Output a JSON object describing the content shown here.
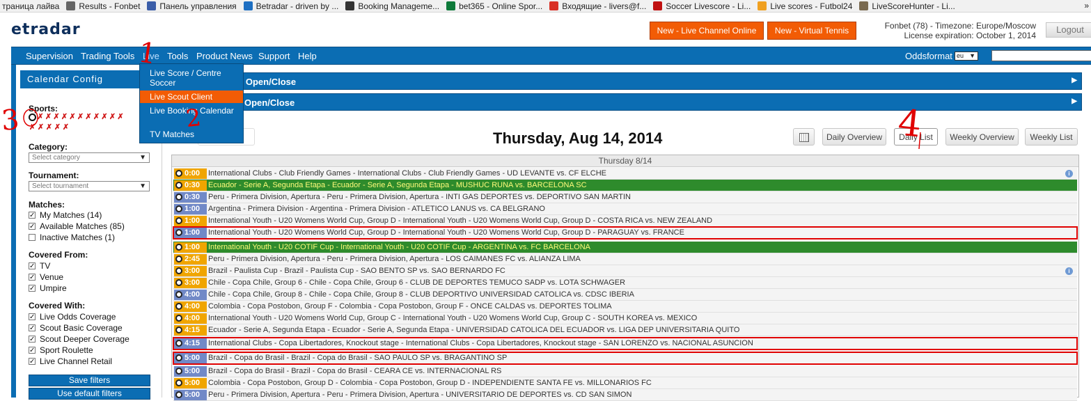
{
  "bookmarks": [
    {
      "label": "траница лайва",
      "color": "#ffffff"
    },
    {
      "label": "Results - Fonbet",
      "color": "#666666"
    },
    {
      "label": "Панель управления",
      "color": "#3a5da8"
    },
    {
      "label": "Betradar - driven by ...",
      "color": "#1d6fc2"
    },
    {
      "label": "Booking Manageme...",
      "color": "#333333"
    },
    {
      "label": "bet365 - Online Spor...",
      "color": "#0e7a3a"
    },
    {
      "label": "Входящие - livers@f...",
      "color": "#d93025"
    },
    {
      "label": "Soccer Livescore - Li...",
      "color": "#c01010"
    },
    {
      "label": "Live scores - Futbol24",
      "color": "#f0a020"
    },
    {
      "label": "LiveScoreHunter - Li...",
      "color": "#7a6a50"
    }
  ],
  "bookmarks_more": "»",
  "logo": "etradar",
  "header": {
    "btn_live_channel": "New - Live Channel Online",
    "btn_virtual_tennis": "New - Virtual Tennis",
    "account_line1": "Fonbet (78)  -  Timezone: Europe/Moscow",
    "account_line2": "License expiration: October 1, 2014",
    "logout": "Logout"
  },
  "nav": {
    "items": [
      "Supervision",
      "Trading Tools",
      "Live",
      "Tools",
      "Product News",
      "Support",
      "Help"
    ],
    "oddsformat_label": "Oddsformat",
    "oddsformat_value": "eu"
  },
  "live_menu": {
    "items": [
      "Live Score / Centre Soccer",
      "Live Scout Client",
      "Live Booking Calendar",
      "TV Matches"
    ],
    "highlighted_index": 1
  },
  "calendar_config": {
    "title": "Calendar Config",
    "sports_label": "Sports:",
    "category_label": "Category:",
    "category_placeholder": "Select category",
    "tournament_label": "Tournament:",
    "tournament_placeholder": "Select tournament",
    "matches_label": "Matches:",
    "matches": [
      {
        "label": "My Matches (14)",
        "checked": true
      },
      {
        "label": "Available Matches (85)",
        "checked": true
      },
      {
        "label": "Inactive Matches (1)",
        "checked": false
      }
    ],
    "covered_from_label": "Covered From:",
    "covered_from": [
      {
        "label": "TV",
        "checked": true
      },
      {
        "label": "Venue",
        "checked": true
      },
      {
        "label": "Umpire",
        "checked": true
      }
    ],
    "covered_with_label": "Covered With:",
    "covered_with": [
      {
        "label": "Live Odds Coverage",
        "checked": true
      },
      {
        "label": "Scout Basic Coverage",
        "checked": true
      },
      {
        "label": "Scout Deeper Coverage",
        "checked": true
      },
      {
        "label": "Sport Roulette",
        "checked": true
      },
      {
        "label": "Live Channel Retail",
        "checked": true
      }
    ],
    "save_filters": "Save filters",
    "use_default": "Use default filters"
  },
  "bars": {
    "bar1": "to Open/Close",
    "bar2": "Open/Close"
  },
  "prev_day": "day",
  "date_title": "Thursday, Aug 14, 2014",
  "view_buttons": {
    "daily_overview": "Daily Overview",
    "daily_list": "Daily List",
    "weekly_overview": "Weekly Overview",
    "weekly_list": "Weekly List"
  },
  "day_header": "Thursday 8/14",
  "matches": [
    {
      "time": "0:00",
      "text": "International Clubs - Club Friendly Games - International Clubs - Club Friendly Games - UD LEVANTE vs. CF ELCHE",
      "style": "o",
      "info": true
    },
    {
      "time": "0:30",
      "text": "Ecuador - Serie A, Segunda Etapa - Ecuador - Serie A, Segunda Etapa - MUSHUC RUNA vs. BARCELONA SC",
      "style": "g"
    },
    {
      "time": "0:30",
      "text": "Peru - Primera Division, Apertura - Peru - Primera Division, Apertura - INTI GAS DEPORTES vs. DEPORTIVO SAN MARTIN",
      "style": "b"
    },
    {
      "time": "1:00",
      "text": "Argentina - Primera Division - Argentina - Primera Division - ATLETICO LANUS vs. CA BELGRANO",
      "style": "b"
    },
    {
      "time": "1:00",
      "text": "International Youth - U20 Womens World Cup, Group D - International Youth - U20 Womens World Cup, Group D - COSTA RICA vs. NEW ZEALAND",
      "style": "o"
    },
    {
      "time": "1:00",
      "text": "International Youth - U20 Womens World Cup, Group D - International Youth - U20 Womens World Cup, Group D - PARAGUAY vs. FRANCE",
      "style": "b",
      "red": true
    },
    {
      "time": "1:00",
      "text": "International Youth - U20 COTIF Cup - International Youth - U20 COTIF Cup - ARGENTINA vs. FC BARCELONA",
      "style": "g"
    },
    {
      "time": "2:45",
      "text": "Peru - Primera Division, Apertura - Peru - Primera Division, Apertura - LOS CAIMANES FC vs. ALIANZA LIMA",
      "style": "o"
    },
    {
      "time": "3:00",
      "text": "Brazil - Paulista Cup - Brazil - Paulista Cup - SAO BENTO SP vs. SAO BERNARDO FC",
      "style": "o",
      "info": true
    },
    {
      "time": "3:00",
      "text": "Chile - Copa Chile, Group 6 - Chile - Copa Chile, Group 6 - CLUB DE DEPORTES TEMUCO SADP vs. LOTA SCHWAGER",
      "style": "o"
    },
    {
      "time": "4:00",
      "text": "Chile - Copa Chile, Group 8 - Chile - Copa Chile, Group 8 - CLUB DEPORTIVO UNIVERSIDAD CATOLICA vs. CDSC IBERIA",
      "style": "b"
    },
    {
      "time": "4:00",
      "text": "Colombia - Copa Postobon, Group F - Colombia - Copa Postobon, Group F - ONCE CALDAS vs. DEPORTES TOLIMA",
      "style": "o"
    },
    {
      "time": "4:00",
      "text": "International Youth - U20 Womens World Cup, Group C - International Youth - U20 Womens World Cup, Group C - SOUTH KOREA vs. MEXICO",
      "style": "o"
    },
    {
      "time": "4:15",
      "text": "Ecuador - Serie A, Segunda Etapa - Ecuador - Serie A, Segunda Etapa - UNIVERSIDAD CATOLICA DEL ECUADOR vs. LIGA DEP UNIVERSITARIA QUITO",
      "style": "o"
    },
    {
      "time": "4:15",
      "text": "International Clubs - Copa Libertadores, Knockout stage - International Clubs - Copa Libertadores, Knockout stage - SAN LORENZO vs. NACIONAL ASUNCION",
      "style": "b",
      "red": true
    },
    {
      "time": "5:00",
      "text": "Brazil - Copa do Brasil - Brazil - Copa do Brasil - SAO PAULO SP vs. BRAGANTINO SP",
      "style": "b",
      "red": true
    },
    {
      "time": "5:00",
      "text": "Brazil - Copa do Brasil - Brazil - Copa do Brasil - CEARA CE vs. INTERNACIONAL RS",
      "style": "b"
    },
    {
      "time": "5:00",
      "text": "Colombia - Copa Postobon, Group D - Colombia - Copa Postobon, Group D - INDEPENDIENTE SANTA FE vs. MILLONARIOS FC",
      "style": "o"
    },
    {
      "time": "5:00",
      "text": "Peru - Primera Division, Apertura - Peru - Primera Division, Apertura - UNIVERSITARIO DE DEPORTES vs. CD SAN SIMON",
      "style": "b"
    }
  ],
  "annotations": [
    "1",
    "2",
    "3",
    "4"
  ],
  "colors": {
    "brand_blue": "#0b6db3",
    "accent_orange": "#f25c05",
    "row_green": "#2e8b2c",
    "time_orange": "#f0a500",
    "time_blue": "#7189c7",
    "annotation_red": "#e00000"
  }
}
